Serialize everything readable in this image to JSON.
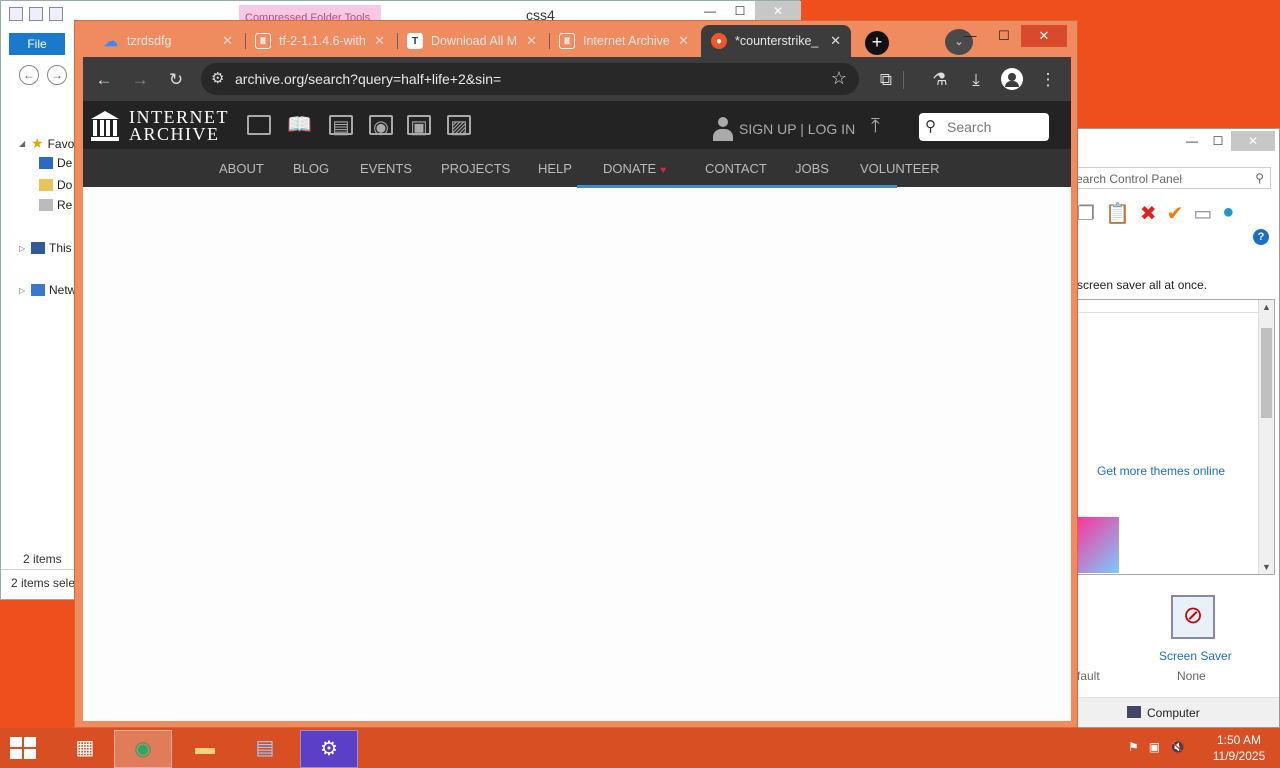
{
  "explorer": {
    "context_tab": "Compressed Folder Tools",
    "title": "css4",
    "file_tab": "File",
    "tree": {
      "favorites": "Favo",
      "desktop": "De",
      "downloads": "Do",
      "recent": "Re",
      "this_pc": "This",
      "network": "Netw"
    },
    "status_items": "2 items",
    "status_selected": "2 items sele"
  },
  "control_panel": {
    "search_placeholder": "earch Control Panel",
    "description": "screen saver all at once.",
    "link_more_themes": "Get more themes online",
    "screen_saver_label": "Screen Saver",
    "screen_saver_value": "None",
    "default_label": "fault",
    "footer_label": "Computer"
  },
  "browser": {
    "tabs": [
      {
        "title": "tzrdsdfg",
        "favicon": "cloud-icon",
        "color": "#3a86ff"
      },
      {
        "title": "tf-2-1.1.4.6-with",
        "favicon": "archive-icon",
        "color": "#ffffff"
      },
      {
        "title": "Download All M",
        "favicon": "t-icon",
        "color": "#ffffff"
      },
      {
        "title": "Internet Archive",
        "favicon": "archive-icon",
        "color": "#ffffff"
      },
      {
        "title": "*counterstrike_",
        "favicon": "flame-icon",
        "color": "#f0562c"
      }
    ],
    "url": "archive.org/search?query=half+life+2&sin="
  },
  "ia": {
    "wordmark_line1": "INTERNET",
    "wordmark_line2": "ARCHIVE",
    "signup": "SIGN UP | LOG IN",
    "search_placeholder": "Search",
    "nav": [
      "ABOUT",
      "BLOG",
      "EVENTS",
      "PROJECTS",
      "HELP",
      "DONATE",
      "CONTACT",
      "JOBS",
      "VOLUNTEER"
    ]
  },
  "taskbar": {
    "time": "1:50 AM",
    "date": "11/9/2025"
  },
  "colors": {
    "desktop": "#ee4f1d",
    "chrome_frame": "#f08a5f",
    "ia_header": "#232323",
    "ia_nav": "#333333",
    "accent": "#428bca"
  }
}
